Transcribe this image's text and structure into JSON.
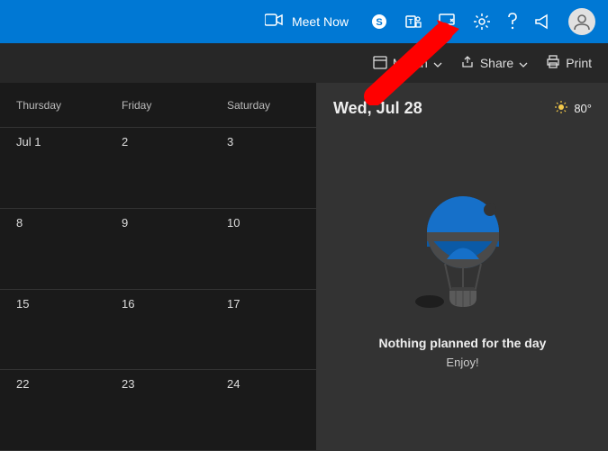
{
  "topbar": {
    "meet_label": "Meet Now"
  },
  "toolbar2": {
    "month_label": "Month",
    "share_label": "Share",
    "print_label": "Print"
  },
  "calendar": {
    "headers": [
      "Thursday",
      "Friday",
      "Saturday"
    ],
    "rows": [
      [
        "Jul 1",
        "2",
        "3"
      ],
      [
        "8",
        "9",
        "10"
      ],
      [
        "15",
        "16",
        "17"
      ],
      [
        "22",
        "23",
        "24"
      ]
    ]
  },
  "detail": {
    "date_label": "Wed, Jul 28",
    "temp": "80°",
    "empty_title": "Nothing planned for the day",
    "empty_sub": "Enjoy!"
  }
}
